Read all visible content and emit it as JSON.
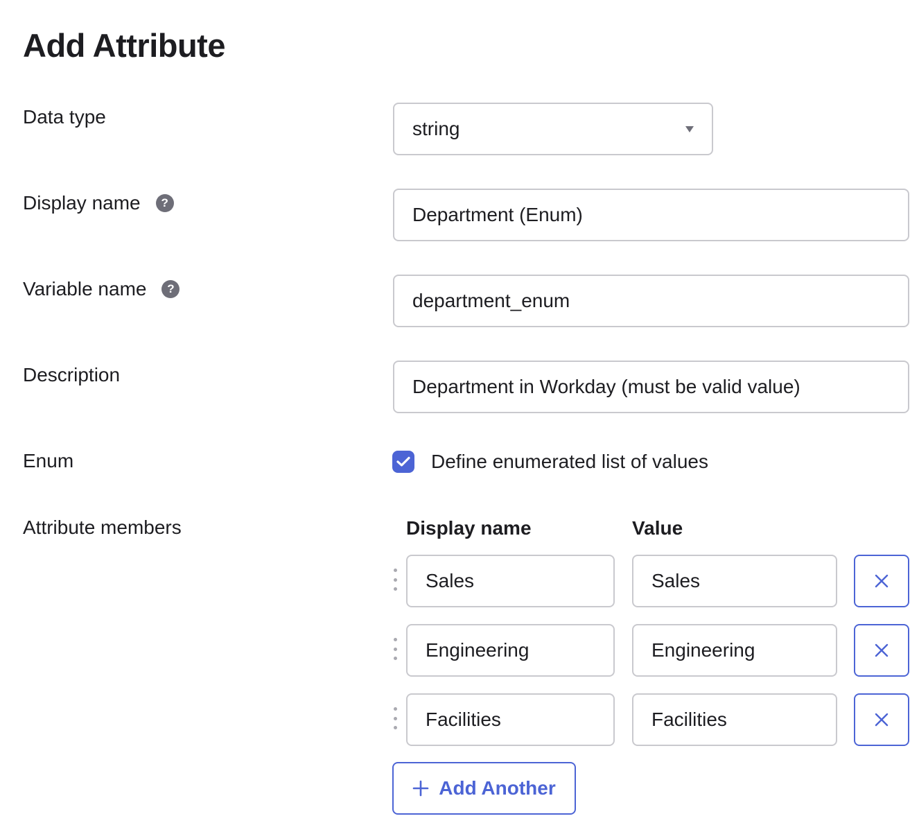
{
  "page": {
    "title": "Add Attribute"
  },
  "form": {
    "data_type": {
      "label": "Data type",
      "value": "string"
    },
    "display_name": {
      "label": "Display name",
      "value": "Department (Enum)",
      "help": "?"
    },
    "variable_name": {
      "label": "Variable name",
      "value": "department_enum",
      "help": "?"
    },
    "description": {
      "label": "Description",
      "value": "Department in Workday (must be valid value)"
    },
    "enum": {
      "label": "Enum",
      "checkbox_label": "Define enumerated list of values",
      "checked": true
    },
    "attribute_members": {
      "label": "Attribute members",
      "col_display_name": "Display name",
      "col_value": "Value",
      "rows": [
        {
          "display_name": "Sales",
          "value": "Sales"
        },
        {
          "display_name": "Engineering",
          "value": "Engineering"
        },
        {
          "display_name": "Facilities",
          "value": "Facilities"
        }
      ],
      "add_label": "Add Another"
    }
  },
  "colors": {
    "accent": "#4c64d5",
    "border": "#c9c9ce",
    "text": "#1d1d21",
    "help_icon": "#6e6e78"
  },
  "icons": {
    "select_caret": "caret-down-icon",
    "help": "question-circle-icon",
    "checkbox": "check-icon",
    "drag": "drag-handle-icon",
    "remove": "close-icon",
    "add": "plus-icon"
  }
}
